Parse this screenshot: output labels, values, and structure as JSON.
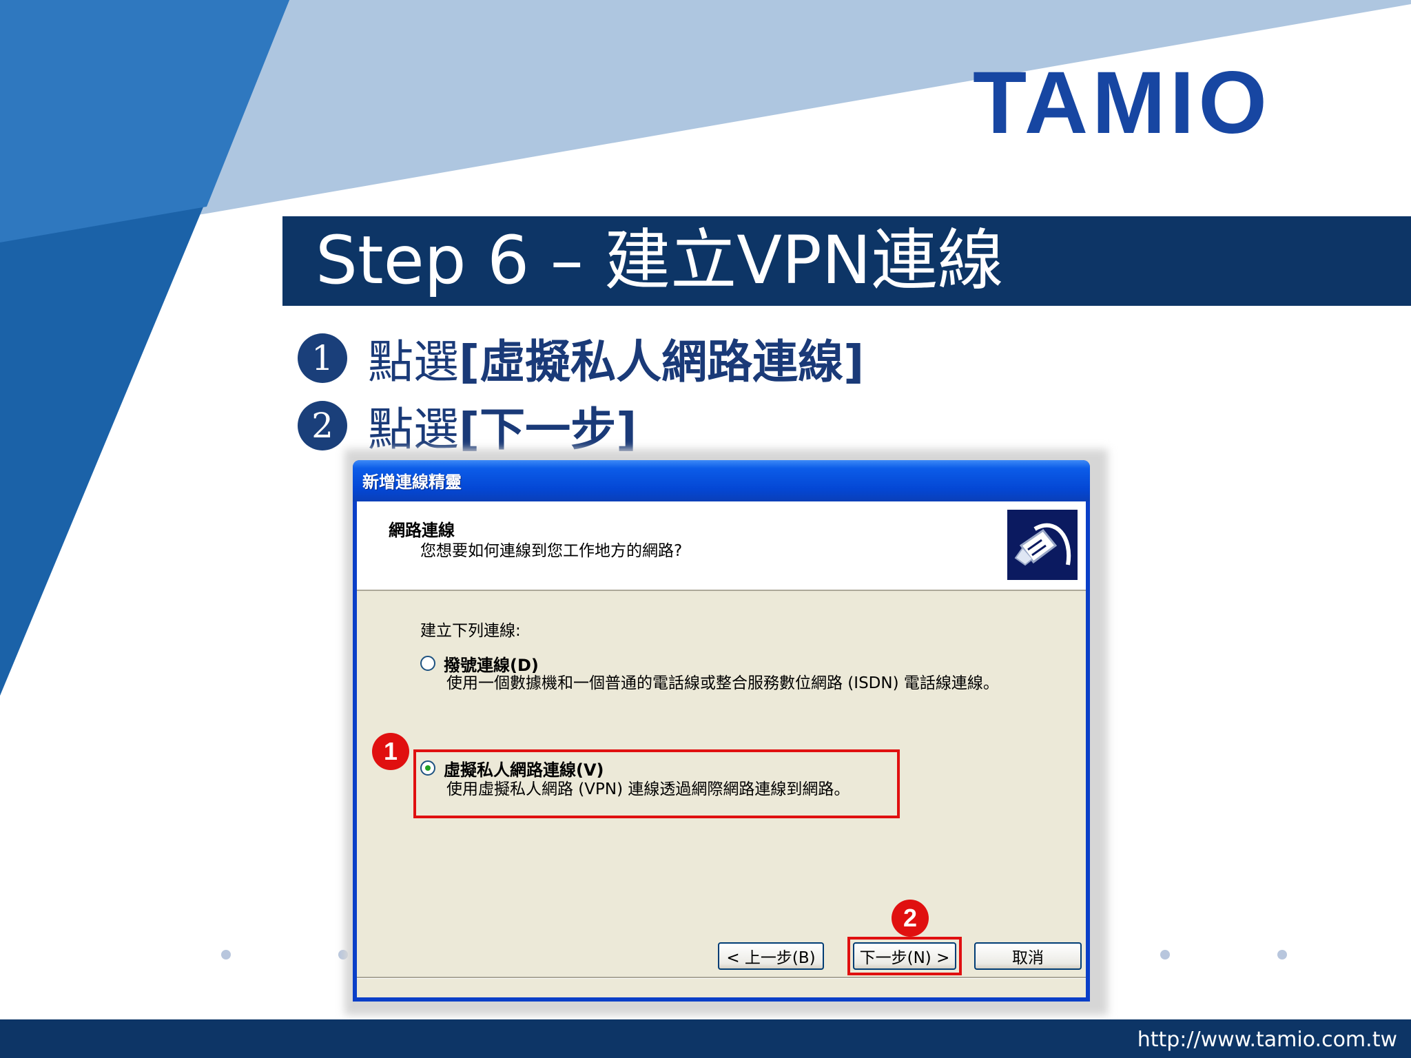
{
  "logo": "TAMIO",
  "title": "Step 6 – 建立VPN連線",
  "steps": [
    {
      "num": "1",
      "prefix": "點選",
      "target": "[虛擬私人網路連線]"
    },
    {
      "num": "2",
      "prefix": "點選",
      "target": "[下一步]"
    }
  ],
  "dialog": {
    "title": "新增連線精靈",
    "header_title": "網路連線",
    "header_subtitle": "您想要如何連線到您工作地方的網路?",
    "icon": "network-plug-icon",
    "section_label": "建立下列連線:",
    "options": [
      {
        "label": "撥號連線(D)",
        "desc": "使用一個數據機和一個普通的電話線或整合服務數位網路 (ISDN) 電話線連線。",
        "selected": false
      },
      {
        "label": "虛擬私人網路連線(V)",
        "desc": "使用虛擬私人網路 (VPN) 連線透過網際網路連線到網路。",
        "selected": true
      }
    ],
    "buttons": {
      "back": "< 上一步(B)",
      "next": "下一步(N) >",
      "cancel": "取消"
    }
  },
  "badges": [
    "1",
    "2"
  ],
  "footer_url": "http://www.tamio.com.tw",
  "colors": {
    "navy": "#0d3566",
    "logo_blue": "#1746a2",
    "highlight_red": "#e01010",
    "xp_blue": "#0447d4"
  }
}
